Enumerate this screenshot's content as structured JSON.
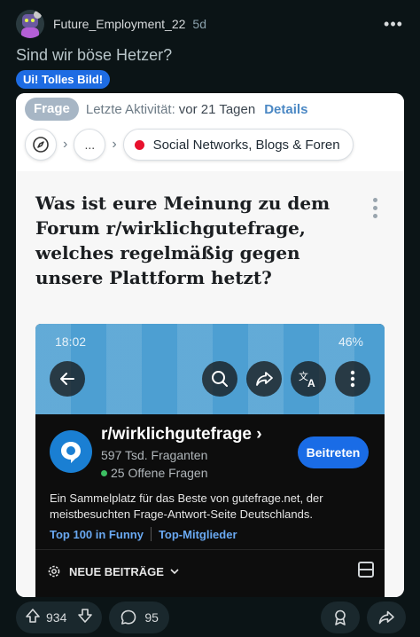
{
  "post": {
    "author": "Future_Employment_22",
    "age": "5d",
    "more_label": "•••",
    "title": "Sind wir böse Hetzer?",
    "flair": "Ui! Tolles Bild!"
  },
  "gf": {
    "badge": "Frage",
    "activity_label": "Letzte Aktivität:",
    "activity_value": "vor 21 Tagen",
    "details": "Details",
    "breadcrumb_more": "...",
    "category": "Social Networks, Blogs & Foren",
    "question": "Was ist eure Meinung zu dem Forum r/wirklichgutefrage, welches regelmäßig gegen unsere Plattform hetzt?"
  },
  "screenshot": {
    "status_time": "18:02",
    "battery": "46%",
    "subreddit": "r/wirklichgutefrage",
    "members": "597 Tsd. Fraganten",
    "online": "25 Offene Fragen",
    "join_label": "Beitreten",
    "description": "Ein Sammelplatz für das Beste von gutefrage.net, der meistbesuchten Frage-Antwort-Seite Deutschlands.",
    "link1": "Top 100 in Funny",
    "link2": "Top-Mitglieder",
    "sort_label": "NEUE BEITRÄGE"
  },
  "actions": {
    "upvotes": "934",
    "comments": "95"
  },
  "colors": {
    "background": "#0b1416",
    "flair": "#1e6ce3",
    "join": "#1a6ce6",
    "banner": "#4d9fd2"
  }
}
